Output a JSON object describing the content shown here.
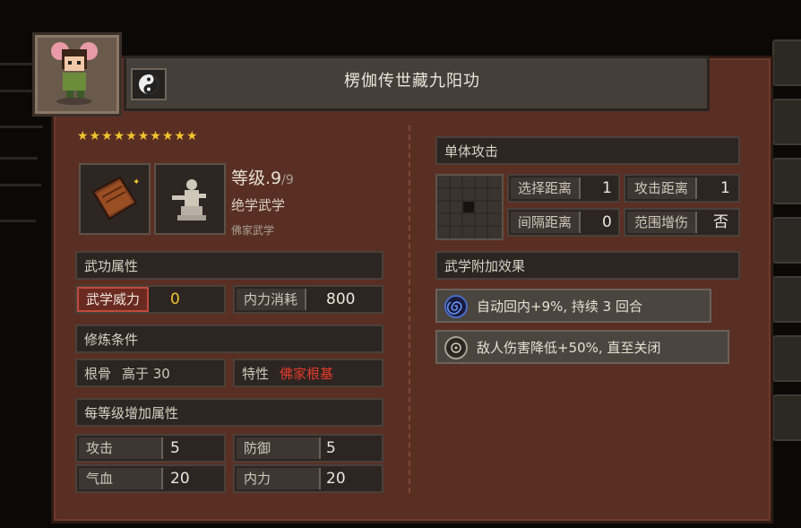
{
  "skill": {
    "name": "楞伽传世藏九阳功",
    "stars": "★★★★★★★★★★",
    "level_label": "等级",
    "level_current": ".9",
    "level_max": "/9",
    "rank": "绝学武学",
    "school": "佛家武学"
  },
  "sections": {
    "attributes": "武功属性",
    "requirements": "修炼条件",
    "per_level": "每等级增加属性",
    "single_attack": "单体攻击",
    "bonus_effects": "武学附加效果"
  },
  "attributes": {
    "power_label": "武学威力",
    "power_value": "0",
    "mp_cost_label": "内力消耗",
    "mp_cost_value": "800"
  },
  "requirements": {
    "root_label": "根骨",
    "root_value": "高于 30",
    "trait_label": "特性",
    "trait_value": "佛家根基"
  },
  "per_level": {
    "attack_label": "攻击",
    "attack_value": "5",
    "defense_label": "防御",
    "defense_value": "5",
    "hp_label": "气血",
    "hp_value": "20",
    "mp_label": "内力",
    "mp_value": "20"
  },
  "attack": {
    "select_range_label": "选择距离",
    "select_range_value": "1",
    "attack_range_label": "攻击距离",
    "attack_range_value": "1",
    "interval_label": "间隔距离",
    "interval_value": "0",
    "aoe_label": "范围增伤",
    "aoe_value": "否"
  },
  "effects": [
    {
      "text": "自动回内+9%, 持续 3 回合",
      "icon": "spiral-icon"
    },
    {
      "text": "敌人伤害降低+50%, 直至关闭",
      "icon": "crosshair-icon"
    }
  ],
  "colors": {
    "star": "#f2c431",
    "trait": "#e53a2a",
    "power": "#f2c431"
  }
}
